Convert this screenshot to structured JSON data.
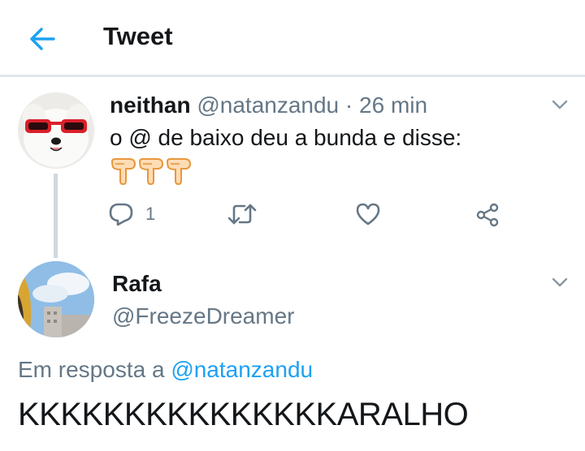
{
  "header": {
    "title": "Tweet",
    "back_icon": "arrow-left-icon",
    "accent_color": "#1da1f2"
  },
  "tweet1": {
    "name": "neithan",
    "handle": "@natanzandu",
    "separator": "·",
    "time": "26 min",
    "text": "o @ de baixo deu a bunda e disse:",
    "emojis": [
      "backhand-index-pointing-down",
      "backhand-index-pointing-down",
      "backhand-index-pointing-down"
    ],
    "reply_count": "1",
    "actions": [
      "reply-icon",
      "retweet-icon",
      "heart-icon",
      "share-icon"
    ]
  },
  "tweet2": {
    "name": "Rafa",
    "handle": "@FreezeDreamer",
    "reply_prefix": "Em resposta a",
    "reply_mention": "@natanzandu",
    "text": "KKKKKKKKKKKKKKKARALHO"
  }
}
